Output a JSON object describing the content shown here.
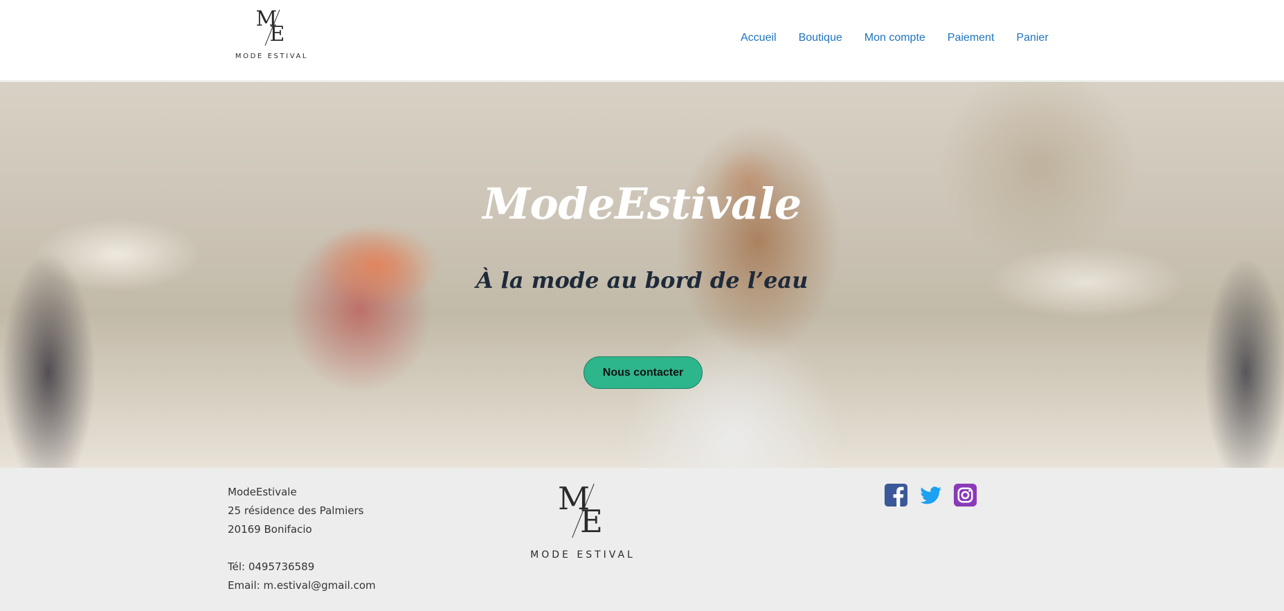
{
  "header": {
    "logo_text": "MODE ESTIVAL",
    "nav": [
      {
        "label": "Accueil"
      },
      {
        "label": "Boutique"
      },
      {
        "label": "Mon compte"
      },
      {
        "label": "Paiement"
      },
      {
        "label": "Panier"
      }
    ]
  },
  "hero": {
    "title": "ModeEstivale",
    "subtitle": "À la mode au bord de l’eau",
    "button_label": "Nous contacter"
  },
  "footer": {
    "company": "ModeEstivale",
    "address_line1": "25 résidence des Palmiers",
    "address_line2": "20169 Bonifacio",
    "phone": "Tél: 0495736589",
    "email": "Email: m.estival@gmail.com",
    "logo_text": "MODE ESTIVAL",
    "social_icons": [
      "facebook-icon",
      "twitter-icon",
      "instagram-icon"
    ]
  },
  "colors": {
    "nav_link": "#1e73be",
    "button_bg": "#2db58c",
    "footer_bg": "#ededed",
    "facebook": "#3b5998",
    "twitter": "#1da1f2",
    "instagram": "#8a3ab9"
  }
}
